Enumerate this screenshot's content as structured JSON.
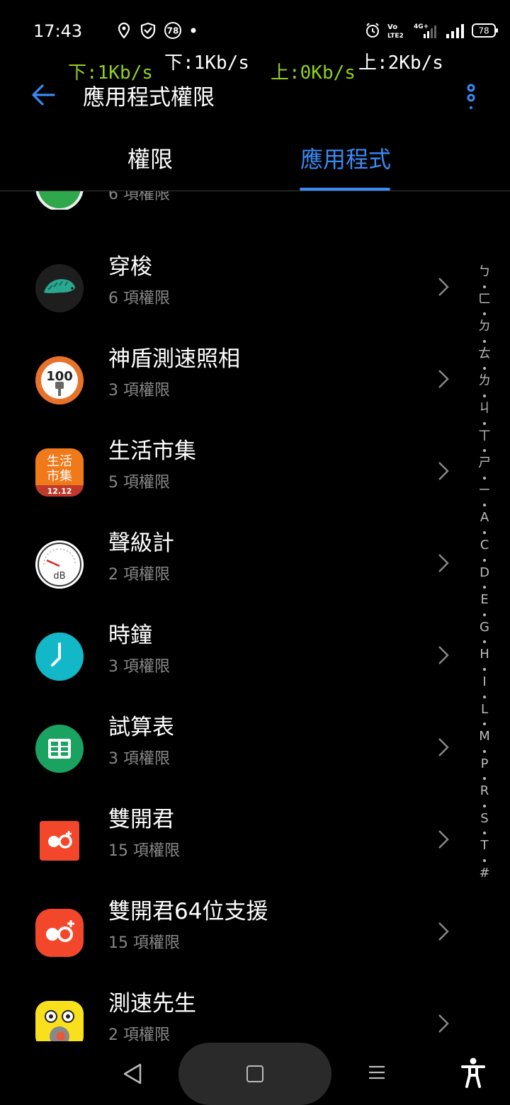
{
  "status_bar": {
    "time": "17:43",
    "battery": "78",
    "notification_badge": "78",
    "network_label": "4G+",
    "volte_label": "Vo LTE2",
    "speed_down_white": "下:1Kb/s",
    "speed_down_green": "下:1Kb/s",
    "speed_up_green": "上:0Kb/s",
    "speed_up_white": "上:2Kb/s"
  },
  "header": {
    "title": "應用程式權限"
  },
  "tabs": [
    {
      "label": "權限",
      "active": false
    },
    {
      "label": "應用程式",
      "active": true
    }
  ],
  "partial_item": {
    "sub": "6 項權限"
  },
  "apps": [
    {
      "name": "穿梭",
      "sub": "6 項權限",
      "icon": "pangolin-icon"
    },
    {
      "name": "神盾測速照相",
      "sub": "3 項權限",
      "icon": "speed-camera-icon"
    },
    {
      "name": "生活市集",
      "sub": "5 項權限",
      "icon": "life-market-icon",
      "icon_text": [
        "生活",
        "市集",
        "12.12"
      ]
    },
    {
      "name": "聲級計",
      "sub": "2 項權限",
      "icon": "sound-meter-icon",
      "icon_text": "dB"
    },
    {
      "name": "時鐘",
      "sub": "3 項權限",
      "icon": "clock-icon"
    },
    {
      "name": "試算表",
      "sub": "3 項權限",
      "icon": "spreadsheet-icon"
    },
    {
      "name": "雙開君",
      "sub": "15 項權限",
      "icon": "dual-app-icon"
    },
    {
      "name": "雙開君64位支援",
      "sub": "15 項權限",
      "icon": "dual-app-64-icon"
    },
    {
      "name": "測速先生",
      "sub": "2 項權限",
      "icon": "mr-speed-icon"
    }
  ],
  "index_letters": [
    "ㄅ",
    "ㄈ",
    "ㄉ",
    "ㄊ",
    "ㄌ",
    "ㄐ",
    "ㄒ",
    "ㄕ",
    "ㄧ",
    "A",
    "C",
    "D",
    "E",
    "G",
    "H",
    "I",
    "L",
    "M",
    "P",
    "R",
    "S",
    "T",
    "#"
  ],
  "colors": {
    "accent": "#3a8bf5",
    "speed_green": "#8fd21b",
    "background": "#000000",
    "secondary_text": "#888888"
  }
}
